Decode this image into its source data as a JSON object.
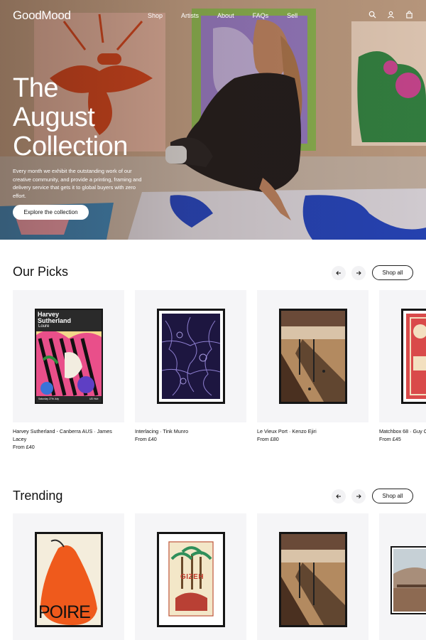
{
  "header": {
    "logo": "GoodMood",
    "nav": [
      "Shop",
      "Artists",
      "About",
      "FAQs",
      "Sell"
    ],
    "icons": [
      "search-icon",
      "user-icon",
      "bag-icon"
    ]
  },
  "hero": {
    "title_lines": [
      "The",
      "August",
      "Collection"
    ],
    "text": "Every month we exhibit the outstanding work of our creative community, and provide a printing, framing and delivery service that gets it to global buyers with zero effort.",
    "button": "Explore the collection"
  },
  "our_picks": {
    "title": "Our Picks",
    "prev_icon": "arrow-left-icon",
    "next_icon": "arrow-right-icon",
    "shop_all": "Shop all",
    "items": [
      {
        "name": "Harvey Sutherland - Canberra AUS · James Lacey",
        "price": "From £40",
        "poster_text": [
          "Harvey",
          "Sutherland",
          "Loure",
          "Saturday 27th July",
          "UD Hub"
        ]
      },
      {
        "name": "Interlacing · Tink Munro",
        "price": "From £40"
      },
      {
        "name": "Le Vieux Port · Kenzo Ejiri",
        "price": "From £80"
      },
      {
        "name": "Matchbox 68 · Guy C",
        "price": "From £45"
      }
    ]
  },
  "trending": {
    "title": "Trending",
    "prev_icon": "arrow-left-icon",
    "next_icon": "arrow-right-icon",
    "shop_all": "Shop all",
    "items": [
      {
        "poster_text": "POIRE"
      },
      {
        "poster_text": "GIZEH"
      },
      {
        "poster_text": ""
      },
      {
        "poster_text": ""
      }
    ]
  },
  "colors": {
    "accent_dark": "#111111",
    "card_bg": "#f5f5f7",
    "button_bg": "#ffffff"
  }
}
